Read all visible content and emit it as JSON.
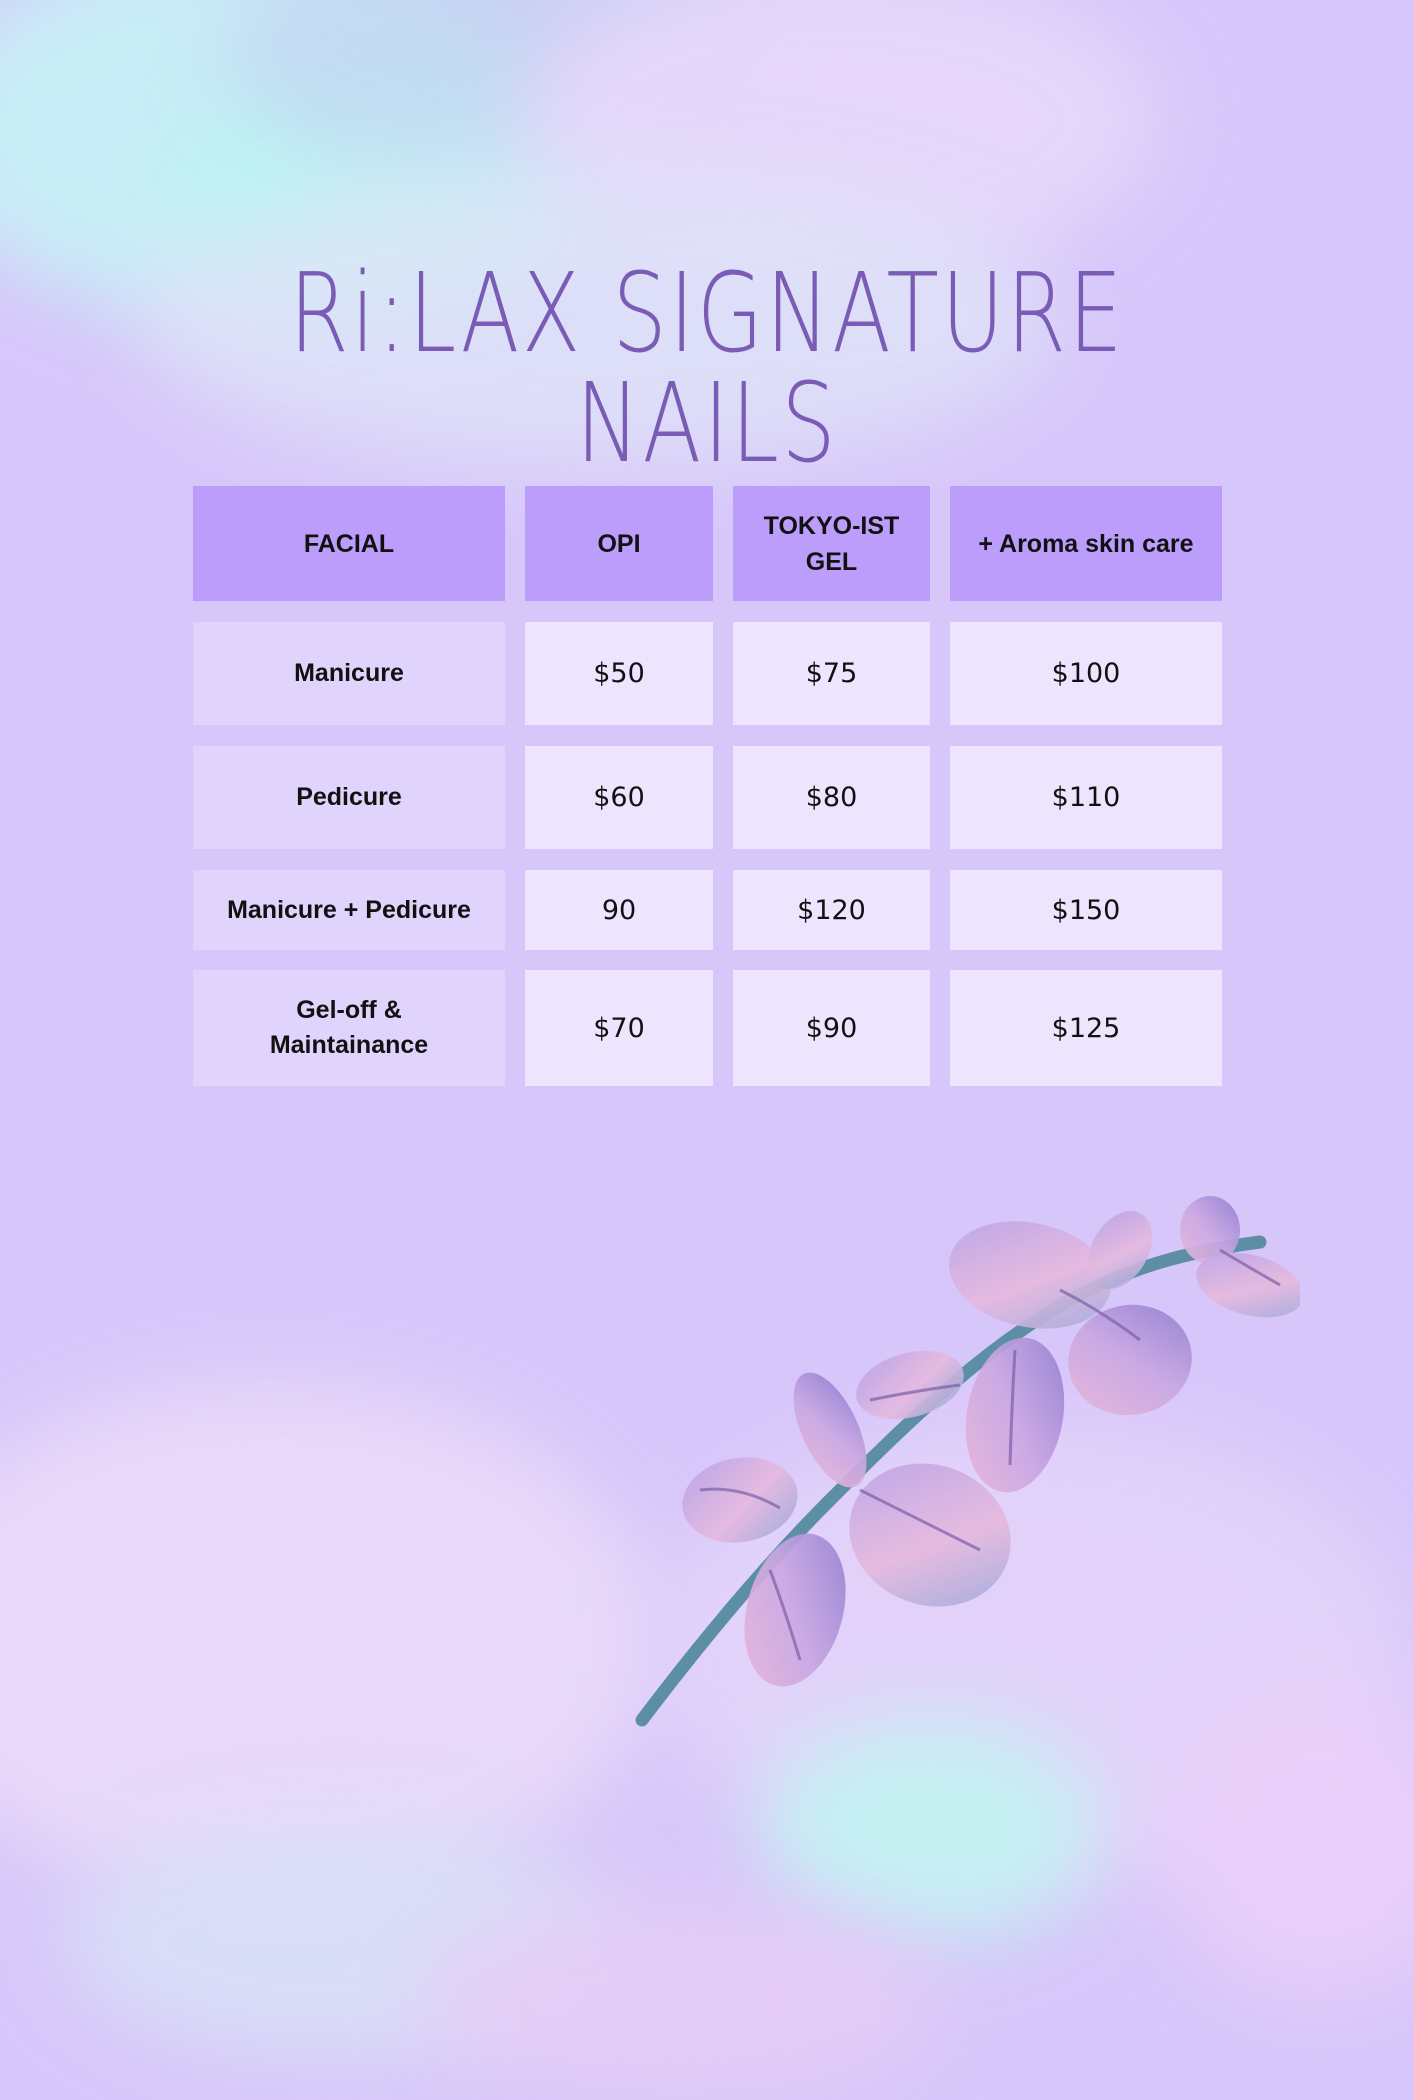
{
  "title": "Ri:LAX SIGNATURE NAILS",
  "table": {
    "headers": [
      "FACIAL",
      "OPI",
      "TOKYO-IST GEL",
      "+ Aroma skin care"
    ],
    "rows": [
      {
        "service": "Manicure",
        "prices": [
          "$50",
          "$75",
          "$100"
        ]
      },
      {
        "service": "Pedicure",
        "prices": [
          "$60",
          "$80",
          "$110"
        ]
      },
      {
        "service": "Manicure + Pedicure",
        "prices": [
          "90",
          "$120",
          "$150"
        ]
      },
      {
        "service": "Gel-off & Maintainance",
        "prices": [
          "$70",
          "$90",
          "$125"
        ]
      }
    ]
  },
  "colors": {
    "background": "#d7c6fa",
    "title": "#7a5cb6",
    "header_cell": "#bd9dfc",
    "label_cell": "#e0d3fc",
    "price_cell": "#ede4fe"
  },
  "decoration": "watercolor-leaf-branch-icon"
}
